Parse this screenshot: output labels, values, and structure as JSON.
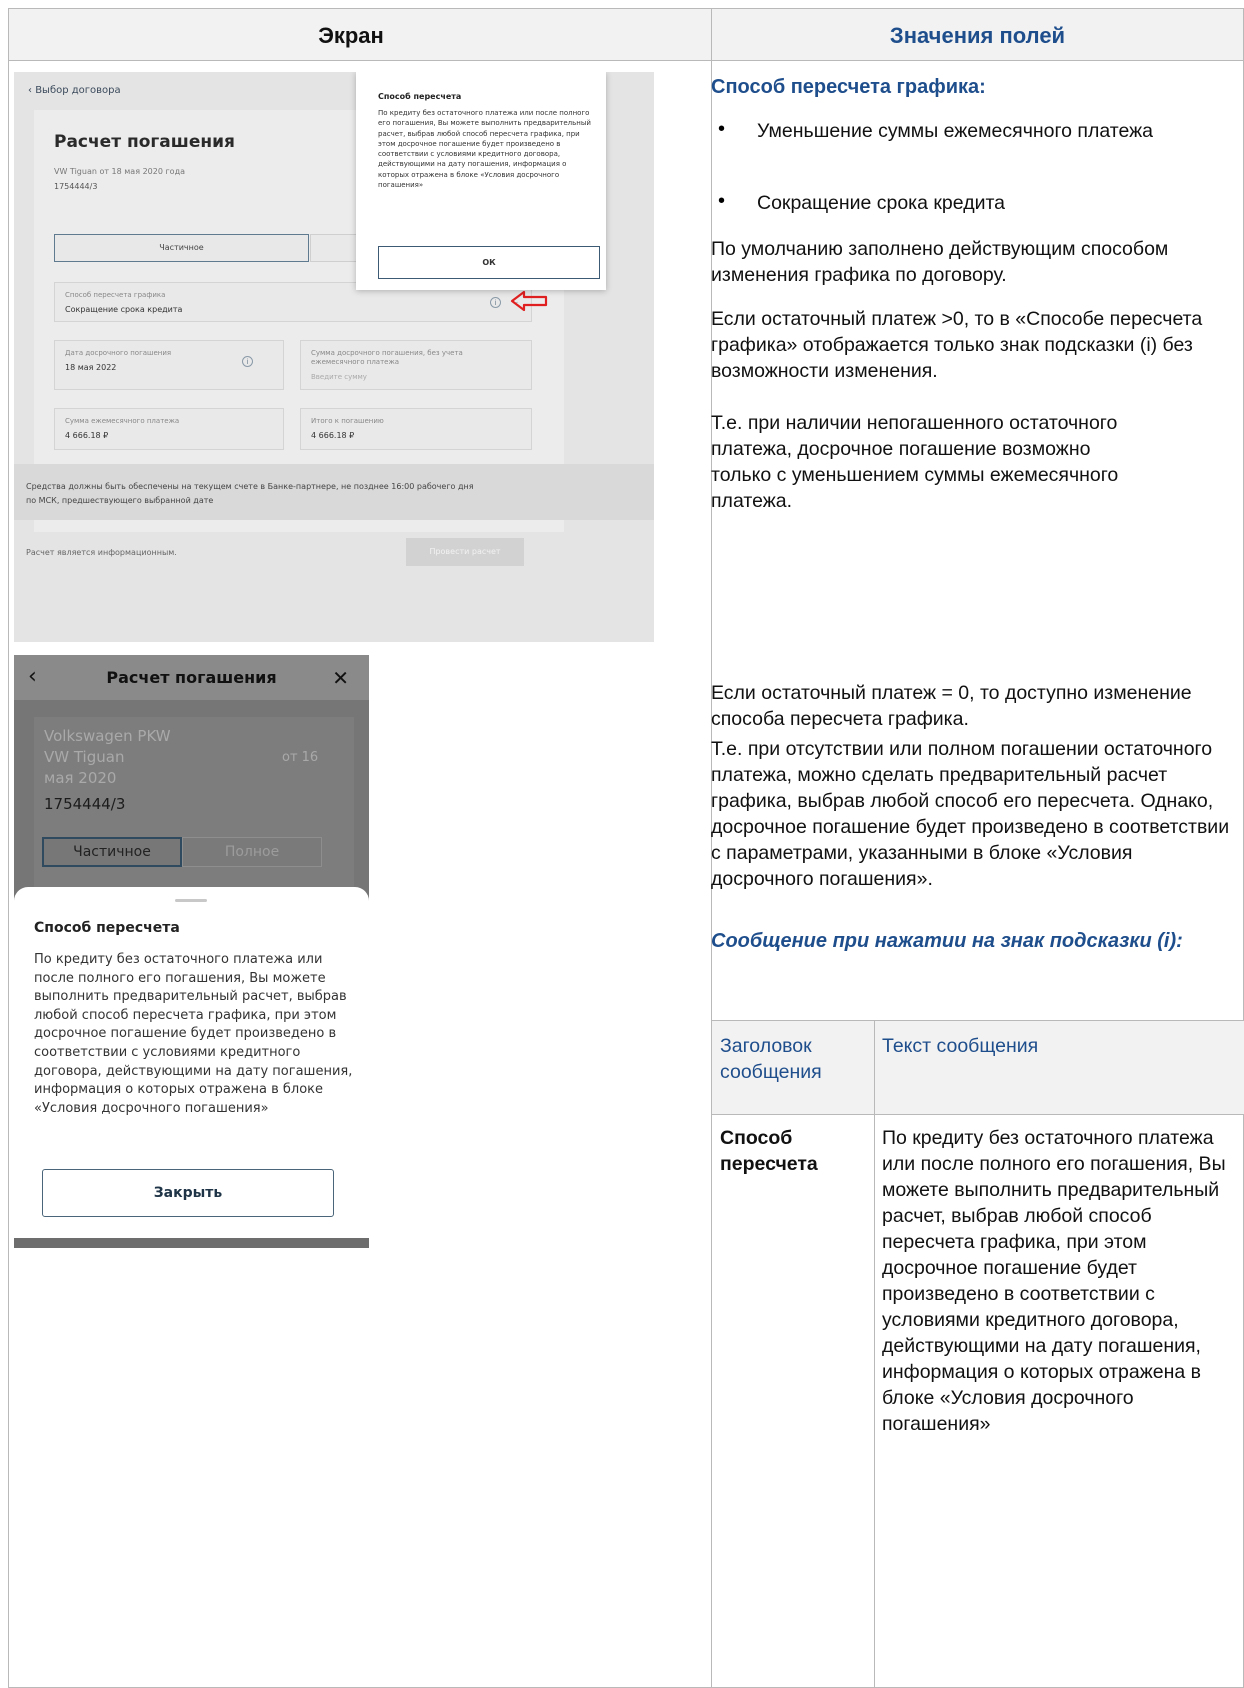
{
  "table_header": {
    "screen": "Экран",
    "values": "Значения полей"
  },
  "desktop": {
    "back_link": "Выбор договора",
    "title": "Расчет погашения",
    "contract_line": "VW Tiguan от 18 мая 2020 года",
    "contract_number": "1754444/3",
    "tab_partial": "Частичное",
    "recalc_label": "Способ пересчета графика",
    "recalc_value": "Сокращение срока кредита",
    "early_date_label": "Дата досрочного погашения",
    "early_date_value": "18 мая 2022",
    "early_sum_label_1": "Сумма досрочного погашения, без учета",
    "early_sum_label_2": "ежемесячного платежа",
    "early_sum_placeholder": "Введите сумму",
    "monthly_label": "Сумма ежемесячного платежа",
    "monthly_value": "4 666.18 ₽",
    "total_label": "Итого к погашению",
    "total_value": "4 666.18 ₽",
    "notice_1": "Средства должны быть обеспечены на текущем счете в Банке-партнере, не позднее 16:00 рабочего дня",
    "notice_2": "по МСК, предшествующего выбранной дате",
    "footer_text": "Расчет является информационным.",
    "calc_button": "Провести расчет",
    "popup": {
      "title": "Способ пересчета",
      "body": "По кредиту без остаточного платежа или после полного его погашения, Вы можете выполнить предварительный расчет, выбрав любой способ пересчета графика, при этом досрочное погашение будет произведено в соответствии с условиями кредитного договора, действующими на дату погашения, информация о которых отражена в блоке «Условия досрочного погашения»",
      "ok": "ОК"
    }
  },
  "mobile": {
    "title": "Расчет погашения",
    "brand": "Volkswagen PKW",
    "model": "VW Tiguan",
    "from": "от 16",
    "date": "мая 2020",
    "number": "1754444/3",
    "tab_partial": "Частичное",
    "tab_full": "Полное",
    "sheet_title": "Способ пересчета",
    "sheet_body": "По кредиту без остаточного платежа или после полного его погашения, Вы можете выполнить предварительный расчет, выбрав любой способ пересчета графика, при этом досрочное погашение будет произведено в соответствии с условиями кредитного договора, действующими на дату погашения, информация о которых отражена в блоке «Условия досрочного погашения»",
    "close_button": "Закрыть"
  },
  "right": {
    "heading": "Способ пересчета графика:",
    "bullets": [
      "Уменьшение суммы ежемесячного платежа",
      "Сокращение срока кредита"
    ],
    "p1": "По умолчанию заполнено действующим способом изменения графика по договору.",
    "p2": "Если остаточный платеж >0, то в «Способе пересчета графика» отображается только знак подсказки (i) без возможности изменения.",
    "p3": "Т.е. при наличии непогашенного остаточного платежа, досрочное погашение возможно только с уменьшением суммы ежемесячного платежа.",
    "p4": "Если остаточный платеж = 0, то доступно изменение способа пересчета графика.",
    "p5": "Т.е. при отсутствии или полном погашении остаточного платежа, можно сделать предварительный расчет графика, выбрав любой способ его пересчета. Однако, досрочное погашение будет произведено в соответствии с параметрами, указанными в блоке «Условия досрочного погашения».",
    "subheading": "Сообщение при нажатии на знак подсказки (i):",
    "table": {
      "col1": "Заголовок сообщения",
      "col2": "Текст сообщения",
      "row_title": "Способ пересчета",
      "row_text": "По кредиту без остаточного платежа или после полного его погашения, Вы можете выполнить предварительный расчет, выбрав любой способ пересчета графика, при этом досрочное погашение будет произведено в соответствии с условиями кредитного договора, действующими на дату погашения, информация о которых отражена в блоке «Условия досрочного погашения»"
    }
  }
}
